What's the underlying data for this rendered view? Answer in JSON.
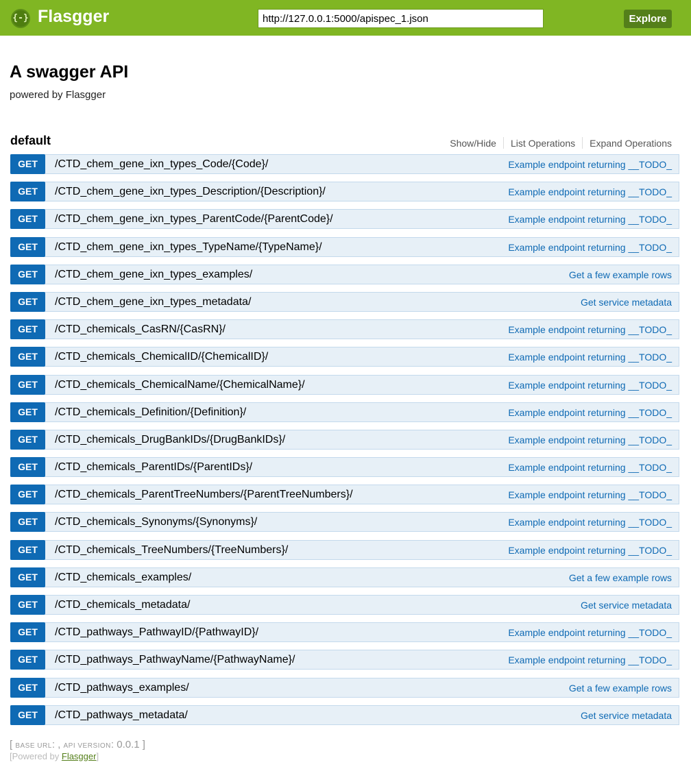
{
  "header": {
    "logo_symbol": "{-}",
    "logo_text": "Flasgger",
    "url_value": "http://127.0.0.1:5000/apispec_1.json",
    "explore_label": "Explore"
  },
  "info": {
    "title": "A swagger API",
    "subtitle": "powered by Flasgger"
  },
  "section": {
    "name": "default",
    "links": [
      "Show/Hide",
      "List Operations",
      "Expand Operations"
    ]
  },
  "operations": [
    {
      "method": "GET",
      "path": "/CTD_chem_gene_ixn_types_Code/{Code}/",
      "summary": "Example endpoint returning __TODO_"
    },
    {
      "method": "GET",
      "path": "/CTD_chem_gene_ixn_types_Description/{Description}/",
      "summary": "Example endpoint returning __TODO_"
    },
    {
      "method": "GET",
      "path": "/CTD_chem_gene_ixn_types_ParentCode/{ParentCode}/",
      "summary": "Example endpoint returning __TODO_"
    },
    {
      "method": "GET",
      "path": "/CTD_chem_gene_ixn_types_TypeName/{TypeName}/",
      "summary": "Example endpoint returning __TODO_"
    },
    {
      "method": "GET",
      "path": "/CTD_chem_gene_ixn_types_examples/",
      "summary": "Get a few example rows"
    },
    {
      "method": "GET",
      "path": "/CTD_chem_gene_ixn_types_metadata/",
      "summary": "Get service metadata"
    },
    {
      "method": "GET",
      "path": "/CTD_chemicals_CasRN/{CasRN}/",
      "summary": "Example endpoint returning __TODO_"
    },
    {
      "method": "GET",
      "path": "/CTD_chemicals_ChemicalID/{ChemicalID}/",
      "summary": "Example endpoint returning __TODO_"
    },
    {
      "method": "GET",
      "path": "/CTD_chemicals_ChemicalName/{ChemicalName}/",
      "summary": "Example endpoint returning __TODO_"
    },
    {
      "method": "GET",
      "path": "/CTD_chemicals_Definition/{Definition}/",
      "summary": "Example endpoint returning __TODO_"
    },
    {
      "method": "GET",
      "path": "/CTD_chemicals_DrugBankIDs/{DrugBankIDs}/",
      "summary": "Example endpoint returning __TODO_"
    },
    {
      "method": "GET",
      "path": "/CTD_chemicals_ParentIDs/{ParentIDs}/",
      "summary": "Example endpoint returning __TODO_"
    },
    {
      "method": "GET",
      "path": "/CTD_chemicals_ParentTreeNumbers/{ParentTreeNumbers}/",
      "summary": "Example endpoint returning __TODO_"
    },
    {
      "method": "GET",
      "path": "/CTD_chemicals_Synonyms/{Synonyms}/",
      "summary": "Example endpoint returning __TODO_"
    },
    {
      "method": "GET",
      "path": "/CTD_chemicals_TreeNumbers/{TreeNumbers}/",
      "summary": "Example endpoint returning __TODO_"
    },
    {
      "method": "GET",
      "path": "/CTD_chemicals_examples/",
      "summary": "Get a few example rows"
    },
    {
      "method": "GET",
      "path": "/CTD_chemicals_metadata/",
      "summary": "Get service metadata"
    },
    {
      "method": "GET",
      "path": "/CTD_pathways_PathwayID/{PathwayID}/",
      "summary": "Example endpoint returning __TODO_"
    },
    {
      "method": "GET",
      "path": "/CTD_pathways_PathwayName/{PathwayName}/",
      "summary": "Example endpoint returning __TODO_"
    },
    {
      "method": "GET",
      "path": "/CTD_pathways_examples/",
      "summary": "Get a few example rows"
    },
    {
      "method": "GET",
      "path": "/CTD_pathways_metadata/",
      "summary": "Get service metadata"
    }
  ],
  "footer": {
    "open_bracket": "[",
    "base_url_label": "BASE URL",
    "base_url_value": ": , ",
    "api_version_label": "API VERSION",
    "api_version_value": "0.0.1",
    "close_bracket": "]",
    "powered_prefix": "[Powered by ",
    "powered_link": "Flasgger",
    "powered_suffix": "]"
  },
  "colors": {
    "header_bg": "#80b623",
    "get_method": "#0f6ab4",
    "op_bg": "#e7f0f7",
    "op_border": "#c3d9ec"
  },
  "icons": {
    "logo": "flasgger-logo-icon"
  }
}
